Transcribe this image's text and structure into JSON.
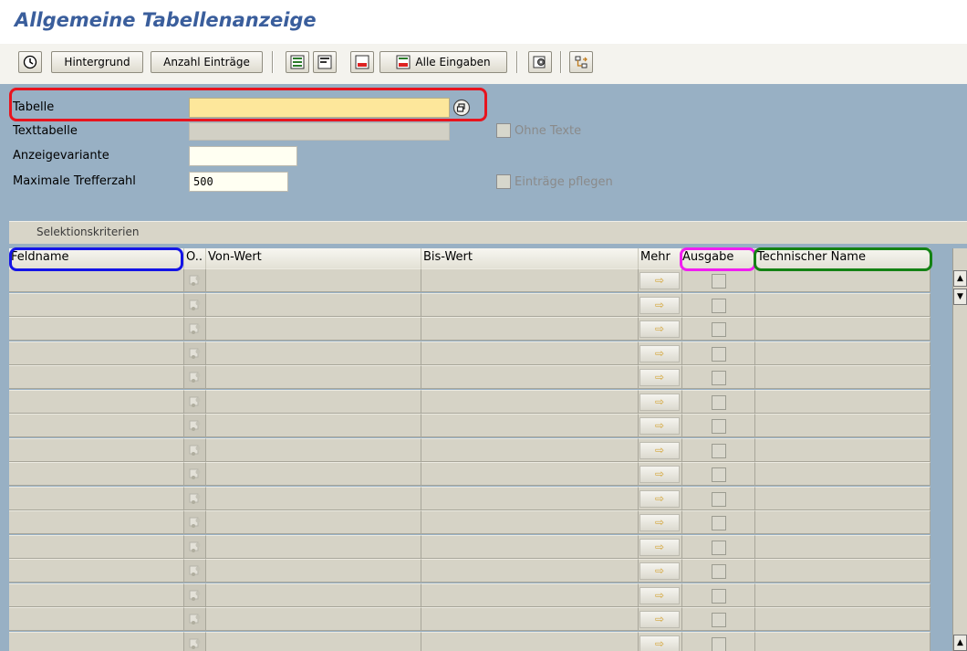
{
  "window": {
    "title": "Allgemeine Tabellenanzeige"
  },
  "toolbar": {
    "execute_icon": "execute-clock-icon",
    "background_label": "Hintergrund",
    "count_label": "Anzahl Einträge",
    "all_entries_label": "Alle Eingaben"
  },
  "form": {
    "table_label": "Tabelle",
    "table_value": "",
    "text_table_label": "Texttabelle",
    "text_table_value": "",
    "display_variant_label": "Anzeigevariante",
    "display_variant_value": "",
    "max_hits_label": "Maximale Trefferzahl",
    "max_hits_value": "500",
    "without_texts_label": "Ohne Texte",
    "maintain_entries_label": "Einträge pflegen"
  },
  "selection": {
    "tab_label": "Selektionskriterien",
    "columns": {
      "fieldname": "Feldname",
      "option": "O..",
      "from": "Von-Wert",
      "to": "Bis-Wert",
      "more": "Mehr",
      "output": "Ausgabe",
      "technical_name": "Technischer Name"
    },
    "row_count": 16,
    "more_button_glyph": "⇨"
  },
  "colors": {
    "title": "#3a5e9c",
    "panel_bg": "#98b0c4",
    "required_field": "#fde79b",
    "highlight_red": "#e8141e",
    "highlight_blue": "#1414e6",
    "highlight_magenta": "#f01ef0",
    "highlight_green": "#148214"
  }
}
